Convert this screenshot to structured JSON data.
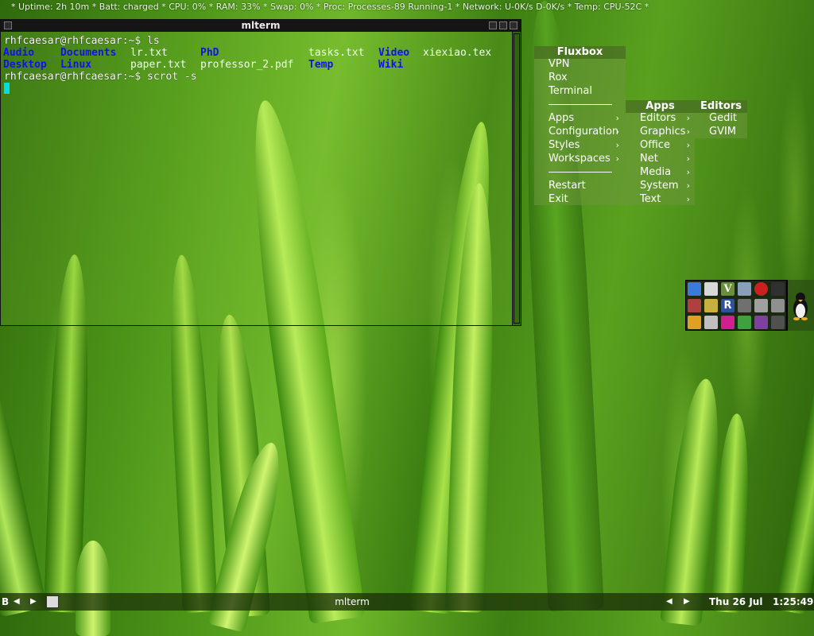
{
  "status_line": "* Uptime: 2h 10m * Batt: charged * CPU: 0% * RAM: 33% * Swap: 0% * Proc: Processes-89 Running-1 * Network: U-0K/s D-0K/s * Temp: CPU-52C *",
  "terminal": {
    "title": "mlterm",
    "prompt1": "rhfcaesar@rhfcaesar:~$ ls",
    "prompt2": "rhfcaesar@rhfcaesar:~$ scrot -s",
    "ls_row1": [
      {
        "text": "Audio",
        "type": "dir"
      },
      {
        "text": "Documents",
        "type": "dir"
      },
      {
        "text": "lr.txt",
        "type": "file"
      },
      {
        "text": "PhD",
        "type": "dir"
      },
      {
        "text": "tasks.txt",
        "type": "file"
      },
      {
        "text": "Video",
        "type": "dir"
      },
      {
        "text": "xiexiao.tex",
        "type": "file"
      }
    ],
    "ls_row2": [
      {
        "text": "Desktop",
        "type": "dir"
      },
      {
        "text": "Linux",
        "type": "dir"
      },
      {
        "text": "paper.txt",
        "type": "file"
      },
      {
        "text": "professor_2.pdf",
        "type": "file"
      },
      {
        "text": "Temp",
        "type": "dir"
      },
      {
        "text": "Wiki",
        "type": "dir"
      }
    ]
  },
  "root_menu": {
    "title": "Fluxbox",
    "items_top": [
      "VPN",
      "Rox",
      "Terminal"
    ],
    "items_mid": [
      "Apps",
      "Configuration",
      "Styles",
      "Workspaces"
    ],
    "items_bottom": [
      "Restart",
      "Exit"
    ]
  },
  "apps_menu": {
    "title": "Apps",
    "items": [
      "Editors",
      "Graphics",
      "Office",
      "Net",
      "Media",
      "System",
      "Text"
    ]
  },
  "editors_menu": {
    "title": "Editors",
    "items": [
      "Gedit",
      "GVIM"
    ]
  },
  "toolbar": {
    "workspace_label": "B",
    "window_title": "mlterm",
    "clock": "Thu 26 Jul   1:25:49"
  },
  "colors": {
    "dir_blue": "#1010f0",
    "cursor_cyan": "#00e0e0"
  }
}
